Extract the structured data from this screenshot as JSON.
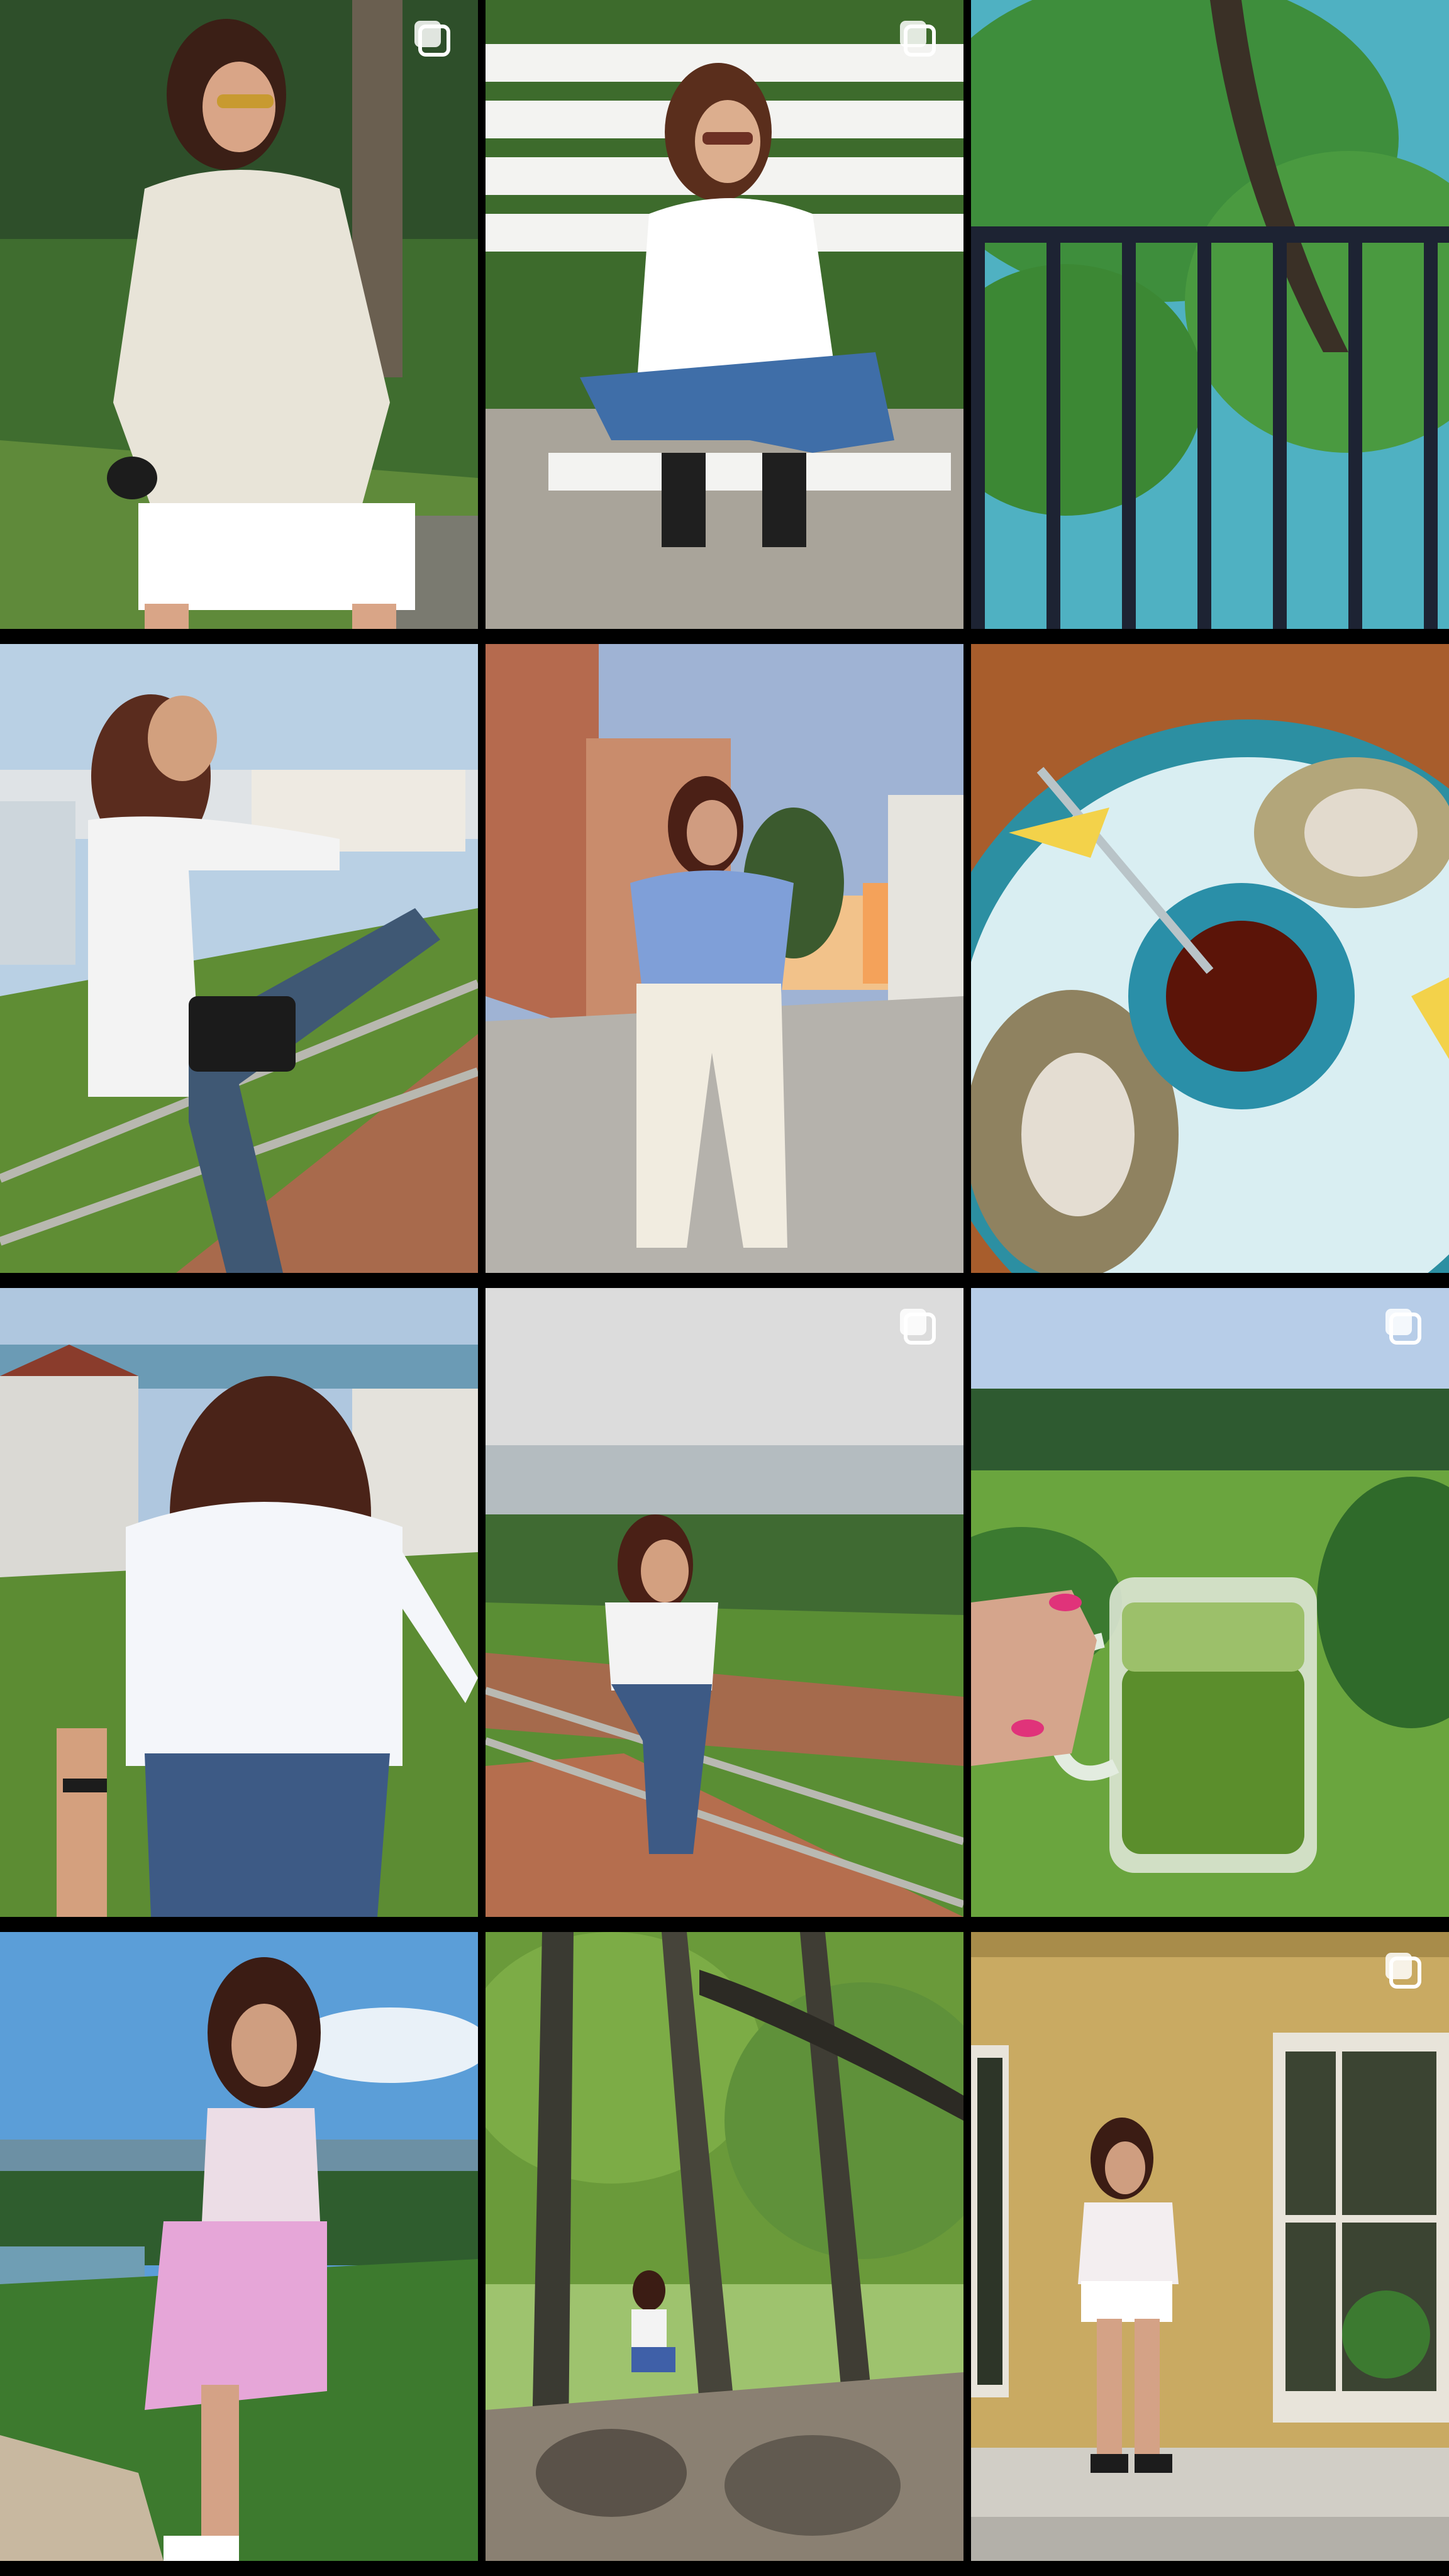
{
  "grid": {
    "posts": [
      {
        "subject": "woman-in-linen-shirt-park",
        "multiple": true
      },
      {
        "subject": "woman-on-white-bench",
        "multiple": true
      },
      {
        "subject": "tree-behind-railing",
        "multiple": false
      },
      {
        "subject": "woman-on-railing-stairs",
        "multiple": false
      },
      {
        "subject": "woman-on-city-street-sunset",
        "multiple": false
      },
      {
        "subject": "oysters-on-ice",
        "multiple": false
      },
      {
        "subject": "woman-leading-by-hand-lawn",
        "multiple": false
      },
      {
        "subject": "woman-on-railing-riverside",
        "multiple": true
      },
      {
        "subject": "green-smoothie-glass",
        "multiple": true
      },
      {
        "subject": "woman-pink-skirt-river-view",
        "multiple": false
      },
      {
        "subject": "woman-in-forest",
        "multiple": false
      },
      {
        "subject": "woman-by-yellow-brick-house",
        "multiple": true
      }
    ]
  },
  "icons": {
    "multiple_posts": "carousel-icon"
  },
  "colors": {
    "background": "#000000",
    "icon": "#ffffff"
  }
}
